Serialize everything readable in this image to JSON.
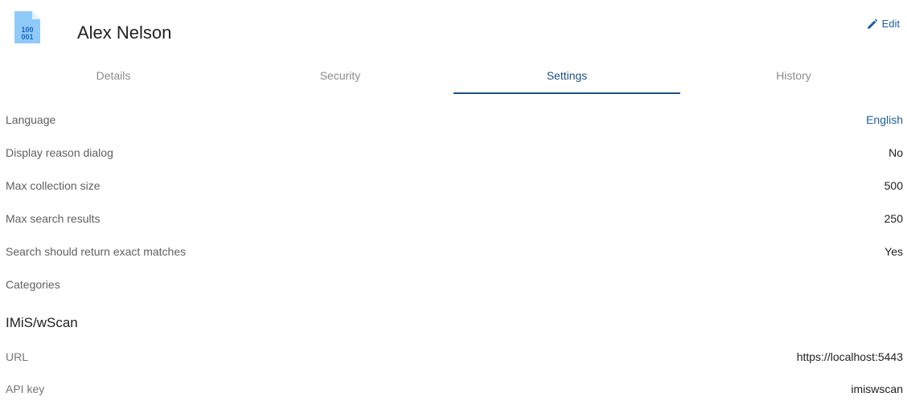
{
  "header": {
    "name": "Alex Nelson",
    "icon": "binary-file-icon",
    "icon_text_line1": "100",
    "icon_text_line2": "001",
    "edit_label": "Edit",
    "accent_color": "#1d5f9e"
  },
  "tabs": [
    {
      "label": "Details",
      "active": false
    },
    {
      "label": "Security",
      "active": false
    },
    {
      "label": "Settings",
      "active": true
    },
    {
      "label": "History",
      "active": false
    }
  ],
  "settings": {
    "language": {
      "label": "Language",
      "value": "English"
    },
    "reason_dialog": {
      "label": "Display reason dialog",
      "value": "No"
    },
    "max_collection": {
      "label": "Max collection size",
      "value": "500"
    },
    "max_search": {
      "label": "Max search results",
      "value": "250"
    },
    "exact_matches": {
      "label": "Search should return exact matches",
      "value": "Yes"
    },
    "categories": {
      "label": "Categories",
      "value": ""
    }
  },
  "imis": {
    "title": "IMiS/wScan",
    "url": {
      "label": "URL",
      "value": "https://localhost:5443"
    },
    "api_key": {
      "label": "API key",
      "value": "imiswscan"
    }
  }
}
